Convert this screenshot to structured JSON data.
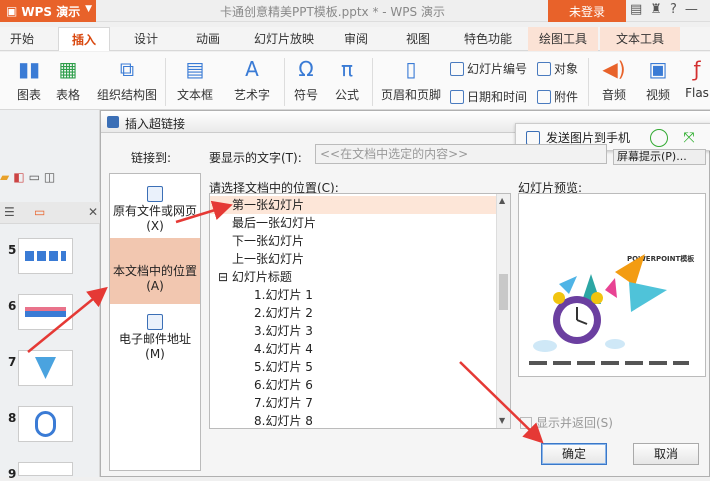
{
  "app": {
    "name": "WPS 演示",
    "doc_title": "卡通创意精美PPT模板.pptx * - WPS 演示",
    "login_label": "未登录"
  },
  "menu_tabs": [
    "开始",
    "插入",
    "设计",
    "动画",
    "幻灯片放映",
    "审阅",
    "视图",
    "特色功能",
    "绘图工具",
    "文本工具"
  ],
  "ribbon": {
    "big": [
      "图表",
      "表格",
      "组织结构图",
      "文本框",
      "艺术字",
      "符号",
      "公式",
      "页眉和页脚",
      "音频",
      "视频",
      "Flas"
    ],
    "small": [
      "幻灯片编号",
      "对象",
      "日期和时间",
      "附件"
    ]
  },
  "slide_numbers": [
    "5",
    "6",
    "7",
    "8",
    "9"
  ],
  "dialog": {
    "title": "插入超链接",
    "send_phone": "发送图片到手机",
    "link_to_label": "链接到:",
    "display_text_label": "要显示的文字(T):",
    "display_text_value": "<<在文档中选定的内容>>",
    "screentip_label": "屏幕提示(P)...",
    "location_label": "请选择文档中的位置(C):",
    "preview_label": "幻灯片预览:",
    "preview_slide_title": "POWERPOINT模板",
    "link_options": [
      {
        "label": "原有文件或网页(X)"
      },
      {
        "label": "本文档中的位置(A)",
        "selected": true
      },
      {
        "label": "电子邮件地址(M)"
      }
    ],
    "tree": [
      {
        "label": "第一张幻灯片",
        "level": 1,
        "selected": true
      },
      {
        "label": "最后一张幻灯片",
        "level": 1
      },
      {
        "label": "下一张幻灯片",
        "level": 1
      },
      {
        "label": "上一张幻灯片",
        "level": 1
      },
      {
        "label": "幻灯片标题",
        "level": 0,
        "expander": "⊟"
      },
      {
        "label": "1.幻灯片 1",
        "level": 2
      },
      {
        "label": "2.幻灯片 2",
        "level": 2
      },
      {
        "label": "3.幻灯片 3",
        "level": 2
      },
      {
        "label": "4.幻灯片 4",
        "level": 2
      },
      {
        "label": "5.幻灯片 5",
        "level": 2
      },
      {
        "label": "6.幻灯片 6",
        "level": 2
      },
      {
        "label": "7.幻灯片 7",
        "level": 2
      },
      {
        "label": "8.幻灯片 8",
        "level": 2
      }
    ],
    "show_and_return": "显示并返回(S)",
    "ok": "确定",
    "cancel": "取消"
  },
  "colors": {
    "accent": "#e8622a",
    "annotation_arrow": "#e53935",
    "selection": "#f2c7b0"
  }
}
